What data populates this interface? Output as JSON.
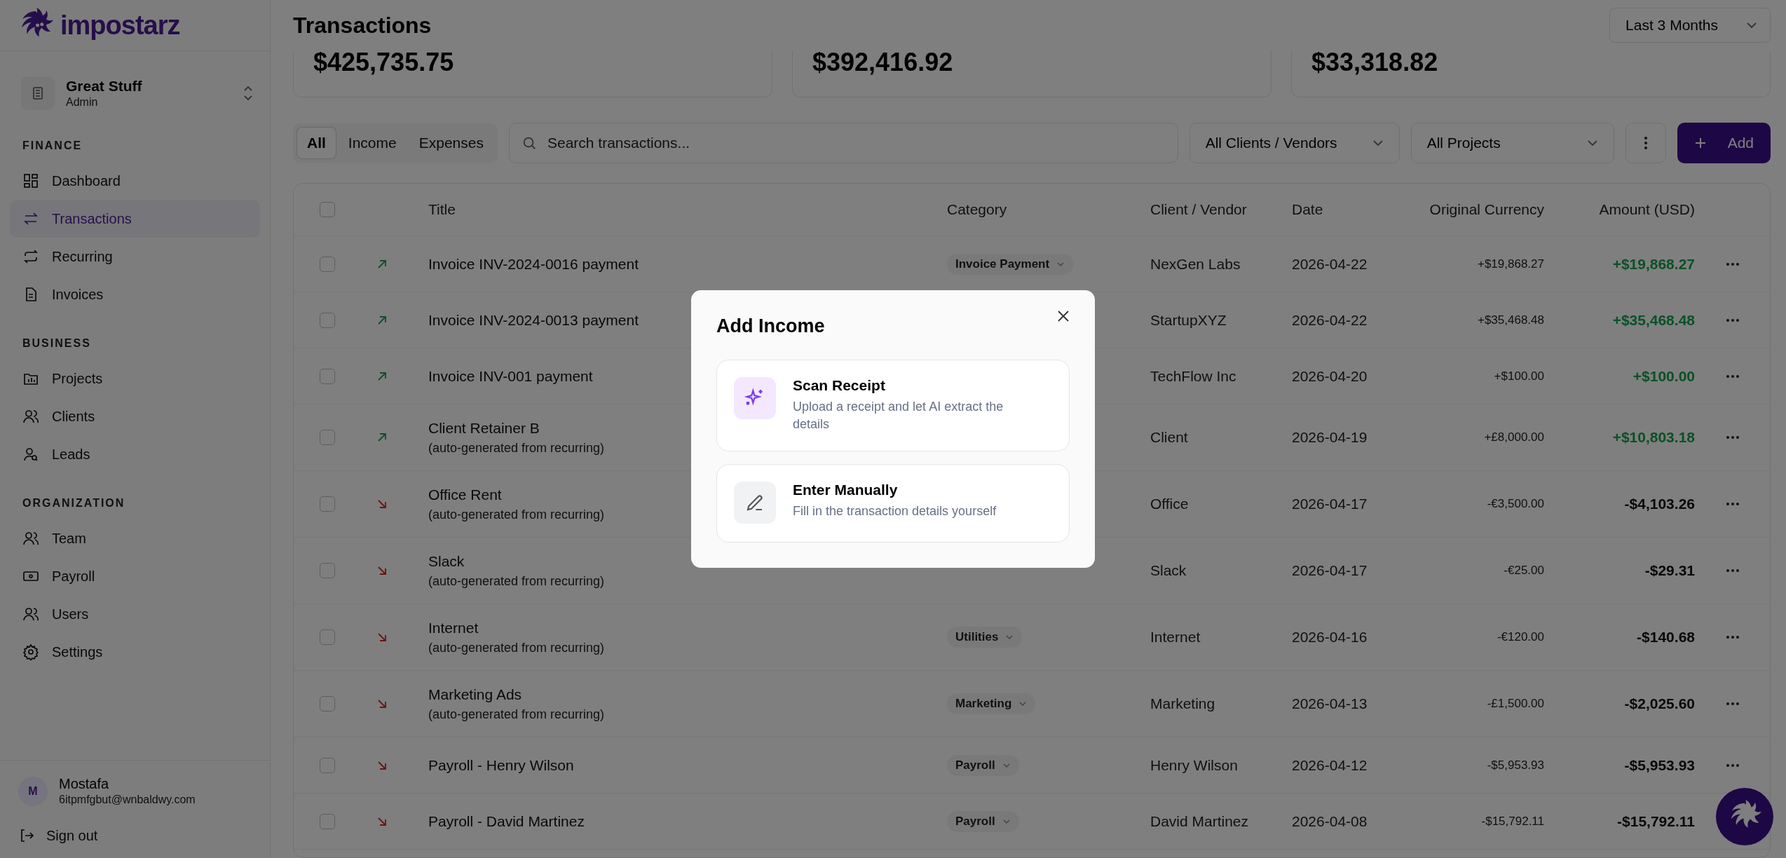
{
  "brand": {
    "name": "impostarz"
  },
  "workspace": {
    "name": "Great Stuff",
    "role": "Admin"
  },
  "sidebar": {
    "sections": [
      {
        "heading": "FINANCE",
        "items": [
          {
            "label": "Dashboard",
            "selected": false
          },
          {
            "label": "Transactions",
            "selected": true
          },
          {
            "label": "Recurring",
            "selected": false
          },
          {
            "label": "Invoices",
            "selected": false
          }
        ]
      },
      {
        "heading": "BUSINESS",
        "items": [
          {
            "label": "Projects",
            "selected": false
          },
          {
            "label": "Clients",
            "selected": false
          },
          {
            "label": "Leads",
            "selected": false
          }
        ]
      },
      {
        "heading": "ORGANIZATION",
        "items": [
          {
            "label": "Team",
            "selected": false
          },
          {
            "label": "Payroll",
            "selected": false
          },
          {
            "label": "Users",
            "selected": false
          },
          {
            "label": "Settings",
            "selected": false
          }
        ]
      }
    ]
  },
  "user": {
    "initial": "M",
    "name": "Mostafa",
    "email": "6itpmfgbut@wnbaldwy.com",
    "sign_out": "Sign out"
  },
  "page": {
    "title": "Transactions",
    "period": "Last 3 Months"
  },
  "stats": [
    "$425,735.75",
    "$392,416.92",
    "$33,318.82"
  ],
  "filters": {
    "tabs": [
      {
        "label": "All",
        "selected": true
      },
      {
        "label": "Income",
        "selected": false
      },
      {
        "label": "Expenses",
        "selected": false
      }
    ],
    "search_placeholder": "Search transactions...",
    "client_filter": "All Clients / Vendors",
    "project_filter": "All Projects",
    "add": "Add"
  },
  "table": {
    "all_checked": false,
    "columns": [
      "Title",
      "Category",
      "Client / Vendor",
      "Date",
      "Original Currency",
      "Amount (USD)"
    ],
    "rows": [
      {
        "kind": "income",
        "checked": false,
        "title": "Invoice INV-2024-0016 payment",
        "category": "Invoice Payment",
        "client": "NexGen Labs",
        "date": "2026-04-22",
        "original": "+$19,868.27",
        "amount": "+$19,868.27"
      },
      {
        "kind": "income",
        "checked": false,
        "title": "Invoice INV-2024-0013 payment",
        "client": "StartupXYZ",
        "date": "2026-04-22",
        "original": "+$35,468.48",
        "amount": "+$35,468.48"
      },
      {
        "kind": "income",
        "checked": false,
        "title": "Invoice INV-001 payment",
        "client": "TechFlow Inc",
        "date": "2026-04-20",
        "original": "+$100.00",
        "amount": "+$100.00"
      },
      {
        "kind": "income",
        "checked": false,
        "title": "Client Retainer B",
        "note": "(auto-generated from recurring)",
        "client": "Client",
        "date": "2026-04-19",
        "original": "+£8,000.00",
        "amount": "+$10,803.18"
      },
      {
        "kind": "expense",
        "checked": false,
        "title": "Office Rent",
        "note": "(auto-generated from recurring)",
        "client": "Office",
        "date": "2026-04-17",
        "original": "-€3,500.00",
        "amount": "-$4,103.26"
      },
      {
        "kind": "expense",
        "checked": false,
        "title": "Slack",
        "note": "(auto-generated from recurring)",
        "client": "Slack",
        "date": "2026-04-17",
        "original": "-€25.00",
        "amount": "-$29.31"
      },
      {
        "kind": "expense",
        "checked": false,
        "title": "Internet",
        "note": "(auto-generated from recurring)",
        "category": "Utilities",
        "client": "Internet",
        "date": "2026-04-16",
        "original": "-€120.00",
        "amount": "-$140.68"
      },
      {
        "kind": "expense",
        "checked": false,
        "title": "Marketing Ads",
        "note": "(auto-generated from recurring)",
        "category": "Marketing",
        "client": "Marketing",
        "date": "2026-04-13",
        "original": "-£1,500.00",
        "amount": "-$2,025.60"
      },
      {
        "kind": "expense",
        "checked": false,
        "title": "Payroll - Henry Wilson",
        "category": "Payroll",
        "client": "Henry Wilson",
        "date": "2026-04-12",
        "original": "-$5,953.93",
        "amount": "-$5,953.93"
      },
      {
        "kind": "expense",
        "checked": false,
        "title": "Payroll - David Martinez",
        "category": "Payroll",
        "client": "David Martinez",
        "date": "2026-04-08",
        "original": "-$15,792.11",
        "amount": "-$15,792.11"
      }
    ]
  },
  "dialog": {
    "title": "Add Income",
    "options": [
      {
        "kind": "scan",
        "title": "Scan Receipt",
        "description": "Upload a receipt and let AI extract the details"
      },
      {
        "kind": "manual",
        "title": "Enter Manually",
        "description": "Fill in the transaction details yourself"
      }
    ]
  }
}
